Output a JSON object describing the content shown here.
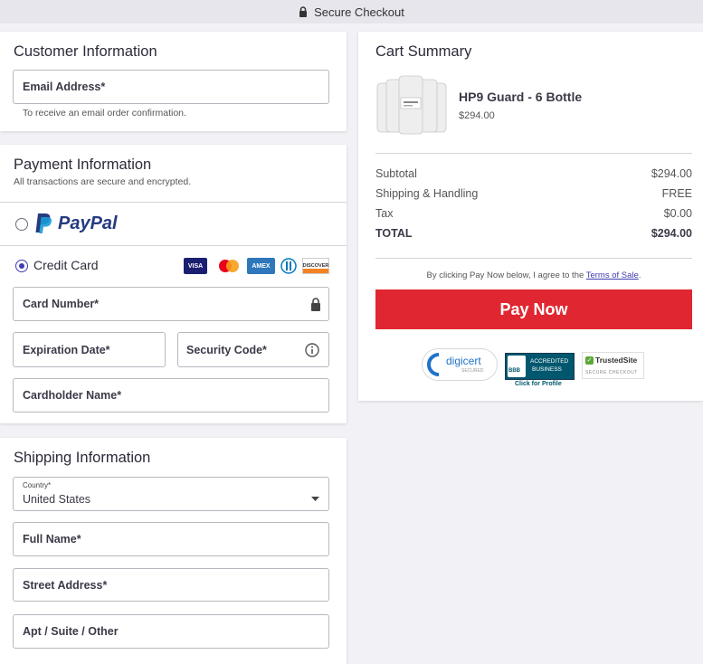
{
  "header": {
    "title": "Secure Checkout"
  },
  "customer": {
    "title": "Customer Information",
    "email_label": "Email Address*",
    "email_hint": "To receive an email order confirmation."
  },
  "payment": {
    "title": "Payment Information",
    "subtitle": "All transactions are secure and encrypted.",
    "paypal_label": "PayPal",
    "credit_label": "Credit Card",
    "selected_method": "credit_card",
    "card_brands": [
      "VISA",
      "mastercard",
      "AMEX",
      "diners",
      "DISCOVER"
    ],
    "card_number_label": "Card Number*",
    "expiration_label": "Expiration Date*",
    "security_label": "Security Code*",
    "cardholder_label": "Cardholder Name*"
  },
  "shipping": {
    "title": "Shipping Information",
    "country_label": "Country*",
    "country_value": "United States",
    "full_name_label": "Full Name*",
    "street_label": "Street Address*",
    "apt_label": "Apt / Suite / Other"
  },
  "cart": {
    "title": "Cart Summary",
    "product_name": "HP9 Guard - 6 Bottle",
    "product_price": "$294.00",
    "subtotal_label": "Subtotal",
    "subtotal_value": "$294.00",
    "shipping_label": "Shipping & Handling",
    "shipping_value": "FREE",
    "tax_label": "Tax",
    "tax_value": "$0.00",
    "total_label": "TOTAL",
    "total_value": "$294.00",
    "terms_prefix": "By clicking Pay Now below, I agree to the",
    "terms_link": "Terms of Sale",
    "terms_suffix": ".",
    "pay_button": "Pay Now"
  },
  "badges": {
    "digicert": "digicert",
    "digicert_sub": "SECURED",
    "bbb_line1": "ACCREDITED",
    "bbb_line2": "BUSINESS",
    "bbb_logo": "BBB",
    "bbb_caption": "Click for Profile",
    "trusted": "TrustedSite",
    "trusted_sub": "SECURE CHECKOUT"
  },
  "colors": {
    "accent": "#3d3bb0",
    "pay_button": "#e02731",
    "paypal_dark": "#253b80",
    "paypal_light": "#179bd7"
  }
}
